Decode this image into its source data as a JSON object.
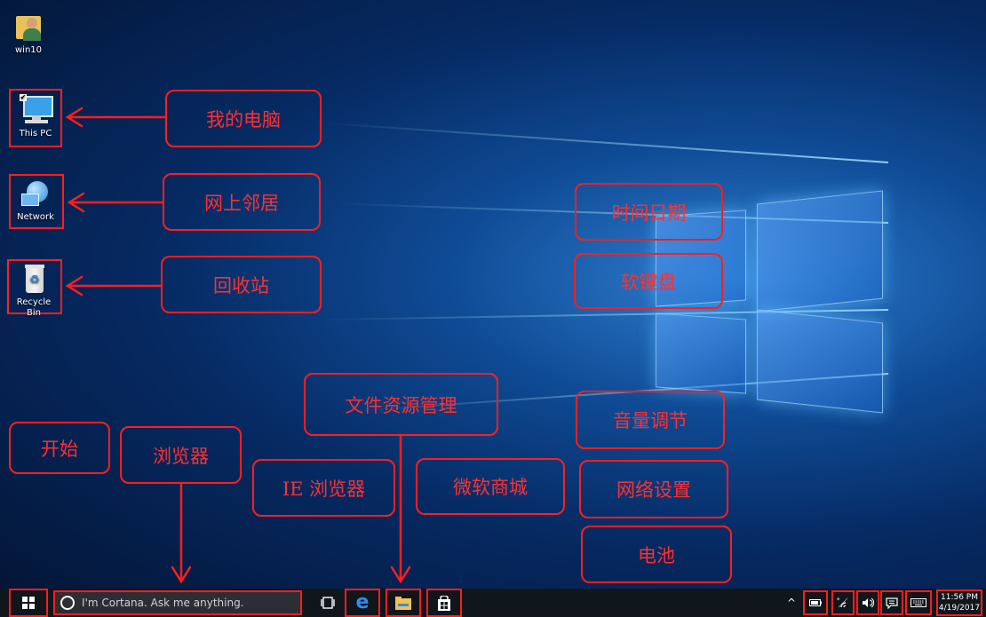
{
  "desktop": {
    "icons": [
      {
        "label": "win10",
        "icon": "user-folder-icon"
      },
      {
        "label": "This PC",
        "icon": "computer-icon"
      },
      {
        "label": "Network",
        "icon": "network-globe-icon"
      },
      {
        "label": "Recycle Bin",
        "icon": "recycle-bin-icon"
      }
    ]
  },
  "callouts": {
    "my_computer": "我的电脑",
    "network": "网上邻居",
    "recycle_bin": "回收站",
    "time_date": "时间日期",
    "soft_keyboard": "软键盘",
    "file_explorer": "文件资源管理",
    "start": "开始",
    "browser": "浏览器",
    "ie_browser": "IE 浏览器",
    "store": "微软商城",
    "volume": "音量调节",
    "network_settings": "网络设置",
    "battery": "电池"
  },
  "taskbar": {
    "start_icon": "windows-logo-icon",
    "search_placeholder": "I'm Cortana. Ask me anything.",
    "pinned": [
      "task-view-icon",
      "edge-icon",
      "file-explorer-icon",
      "store-icon"
    ],
    "tray": [
      "chevron-up-icon",
      "battery-icon",
      "wifi-icon",
      "volume-icon",
      "action-center-icon",
      "keyboard-icon"
    ],
    "clock_time": "11:56 PM",
    "clock_date": "4/19/2017"
  },
  "colors": {
    "annotation": "#ff1e1e",
    "taskbar": "#11161c"
  }
}
